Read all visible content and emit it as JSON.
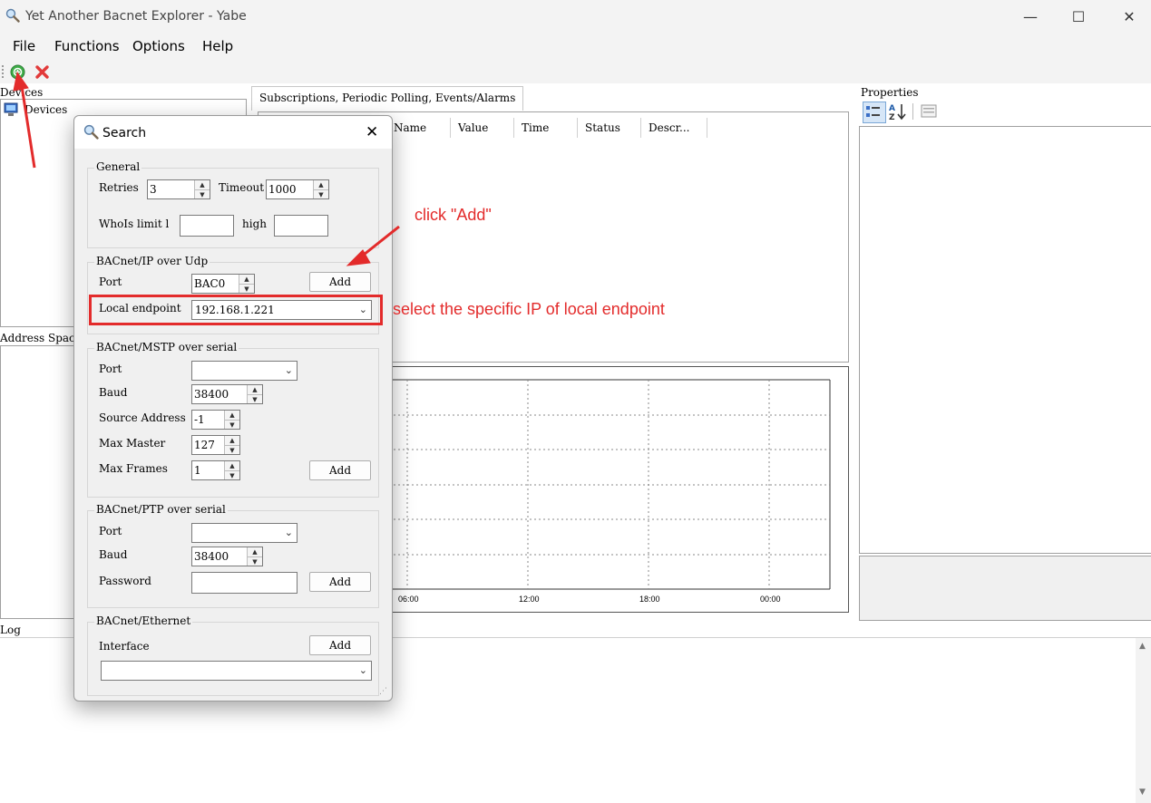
{
  "window": {
    "title": "Yet Another Bacnet Explorer - Yabe",
    "minimize": "—",
    "maximize": "☐",
    "close": "✕"
  },
  "menu": {
    "file": "File",
    "functions": "Functions",
    "options": "Options",
    "help": "Help"
  },
  "panels": {
    "devices": "Devices",
    "devices_tree_root": "Devices",
    "address_space": "Address Spac",
    "properties": "Properties",
    "log": "Log"
  },
  "subscriptions": {
    "tab_label": "Subscriptions, Periodic Polling, Events/Alarms",
    "columns": [
      "Name",
      "Value",
      "Time",
      "Status",
      "Descr..."
    ]
  },
  "graph": {
    "x_ticks": [
      "06:00",
      "12:00",
      "18:00",
      "00:00"
    ]
  },
  "dialog": {
    "title": "Search",
    "close": "✕",
    "general": {
      "title": "General",
      "retries_label": "Retries",
      "retries_value": "3",
      "timeout_label": "Timeout",
      "timeout_value": "1000",
      "whois_label": "WhoIs limit l",
      "whois_low": "",
      "high_label": "high",
      "whois_high": ""
    },
    "ip": {
      "title": "BACnet/IP over Udp",
      "port_label": "Port",
      "port_value": "BAC0",
      "add": "Add",
      "local_endpoint_label": "Local endpoint",
      "local_endpoint_value": "192.168.1.221"
    },
    "mstp": {
      "title": "BACnet/MSTP over serial",
      "port_label": "Port",
      "port_value": "",
      "baud_label": "Baud",
      "baud_value": "38400",
      "source_address_label": "Source Address",
      "source_address_value": "-1",
      "max_master_label": "Max Master",
      "max_master_value": "127",
      "max_frames_label": "Max Frames",
      "max_frames_value": "1",
      "add": "Add"
    },
    "ptp": {
      "title": "BACnet/PTP over serial",
      "port_label": "Port",
      "port_value": "",
      "baud_label": "Baud",
      "baud_value": "38400",
      "password_label": "Password",
      "password_value": "",
      "add": "Add"
    },
    "ethernet": {
      "title": "BACnet/Ethernet",
      "interface_label": "Interface",
      "interface_value": "",
      "add": "Add"
    }
  },
  "annotations": {
    "click_add": "click \"Add\"",
    "select_ip": "select the specific IP of local endpoint"
  },
  "colors": {
    "annotation": "#e32b2b",
    "add_icon": "#3fae49",
    "remove_icon": "#e23a3a"
  }
}
